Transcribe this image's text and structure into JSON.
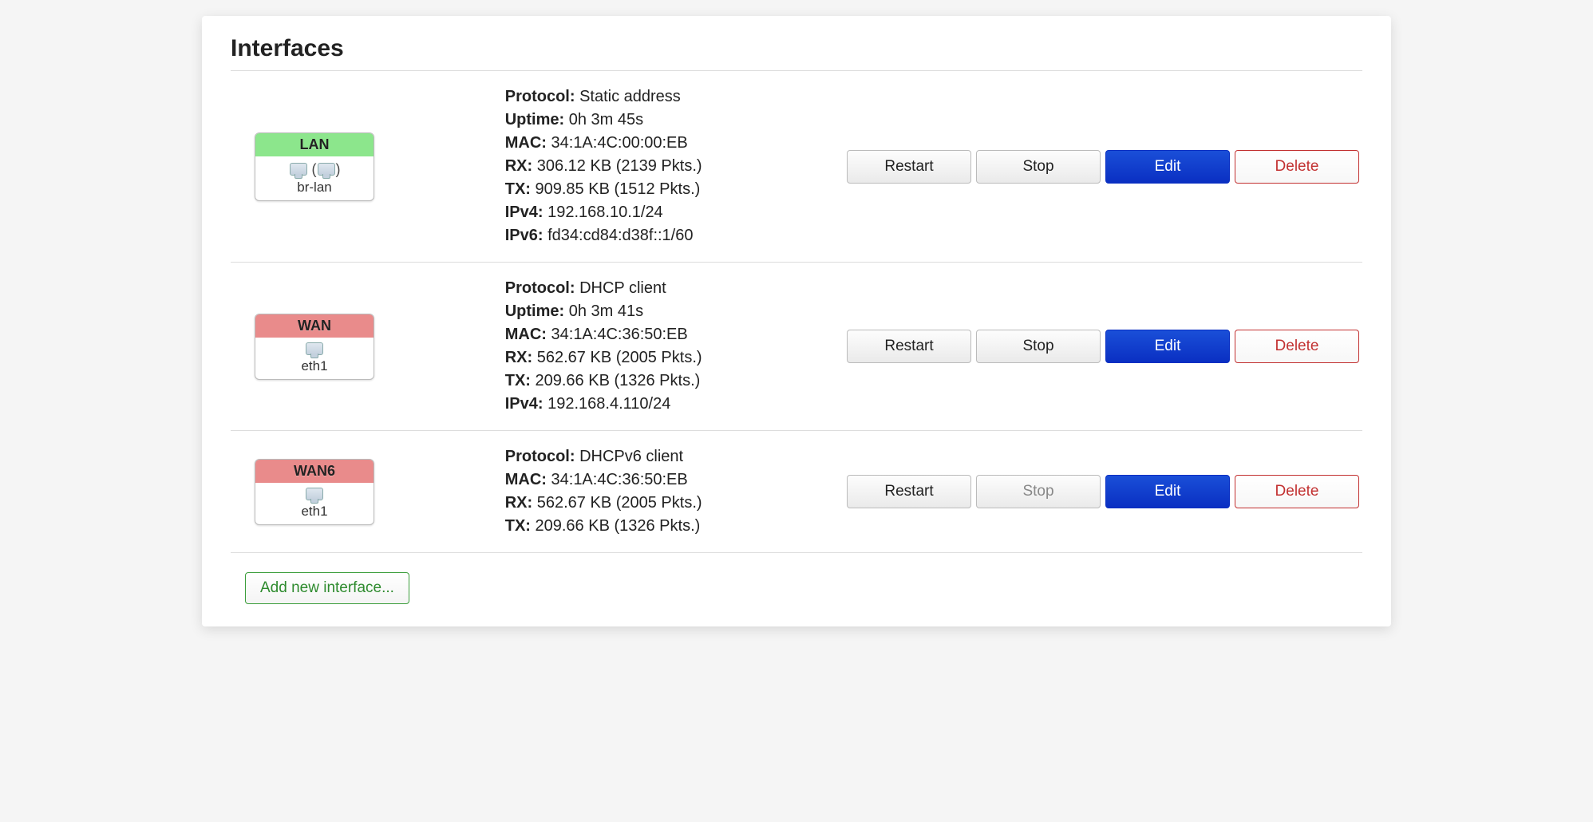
{
  "title": "Interfaces",
  "labels": {
    "protocol": "Protocol:",
    "uptime": "Uptime:",
    "mac": "MAC:",
    "rx": "RX:",
    "tx": "TX:",
    "ipv4": "IPv4:",
    "ipv6": "IPv6:"
  },
  "buttons": {
    "restart": "Restart",
    "stop": "Stop",
    "edit": "Edit",
    "delete": "Delete",
    "add": "Add new interface..."
  },
  "colors": {
    "lan_zone": "#8ce68c",
    "wan_zone": "#e98b8b",
    "primary": "#0a2fc2",
    "danger": "#c23030",
    "add_green": "#2e8b2e"
  },
  "interfaces": [
    {
      "name": "LAN",
      "zone_color": "green",
      "device": "br-lan",
      "is_bridge": true,
      "protocol": "Static address",
      "uptime": "0h 3m 45s",
      "mac": "34:1A:4C:00:00:EB",
      "rx": "306.12 KB (2139 Pkts.)",
      "tx": "909.85 KB (1512 Pkts.)",
      "ipv4": "192.168.10.1/24",
      "ipv6": "fd34:cd84:d38f::1/60",
      "stop_enabled": true
    },
    {
      "name": "WAN",
      "zone_color": "red",
      "device": "eth1",
      "is_bridge": false,
      "protocol": "DHCP client",
      "uptime": "0h 3m 41s",
      "mac": "34:1A:4C:36:50:EB",
      "rx": "562.67 KB (2005 Pkts.)",
      "tx": "209.66 KB (1326 Pkts.)",
      "ipv4": "192.168.4.110/24",
      "ipv6": null,
      "stop_enabled": true
    },
    {
      "name": "WAN6",
      "zone_color": "red",
      "device": "eth1",
      "is_bridge": false,
      "protocol": "DHCPv6 client",
      "uptime": null,
      "mac": "34:1A:4C:36:50:EB",
      "rx": "562.67 KB (2005 Pkts.)",
      "tx": "209.66 KB (1326 Pkts.)",
      "ipv4": null,
      "ipv6": null,
      "stop_enabled": false
    }
  ]
}
